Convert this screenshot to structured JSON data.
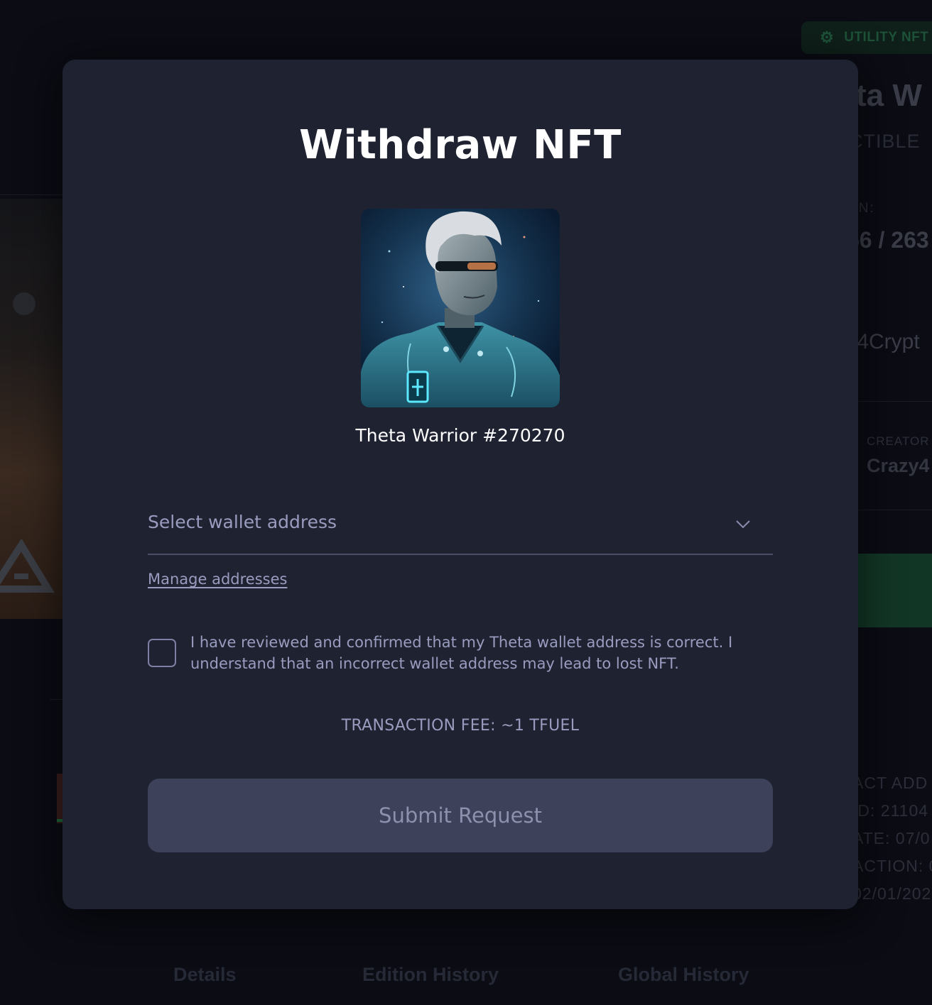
{
  "modal": {
    "title": "Withdraw NFT",
    "nft_name": "Theta Warrior #270270",
    "wallet_select": {
      "placeholder": "Select wallet address",
      "icon": "chevron-down-icon"
    },
    "manage_link": "Manage addresses",
    "confirm": {
      "checked": false,
      "text": "I have reviewed and confirmed that my Theta wallet address is correct. I understand that an incorrect wallet address may lead to lost NFT."
    },
    "fee": "TRANSACTION FEE: ~1 TFUEL",
    "submit_label": "Submit Request"
  },
  "background": {
    "badge": "UTILITY NFT",
    "title_fragment": "ta W",
    "type_fragment": "CTIBLE",
    "edition_label_fragment": "ON:",
    "edition_value_fragment": "56 / 263",
    "owner_fragment": "/4Crypt",
    "creator_label": "CREATOR",
    "creator_value": "Crazy4",
    "meta": [
      "ACT ADD",
      "ID: 21104",
      "ATE: 07/0",
      "ACTION: 0",
      "02/01/202"
    ],
    "tabs": [
      "Details",
      "Edition History",
      "Global History"
    ]
  },
  "colors": {
    "modal_bg": "#1f2231",
    "page_bg": "#0b0c14",
    "muted_text": "#9a9cbf",
    "button_bg": "#3d4159",
    "button_text": "#8e91ad"
  }
}
